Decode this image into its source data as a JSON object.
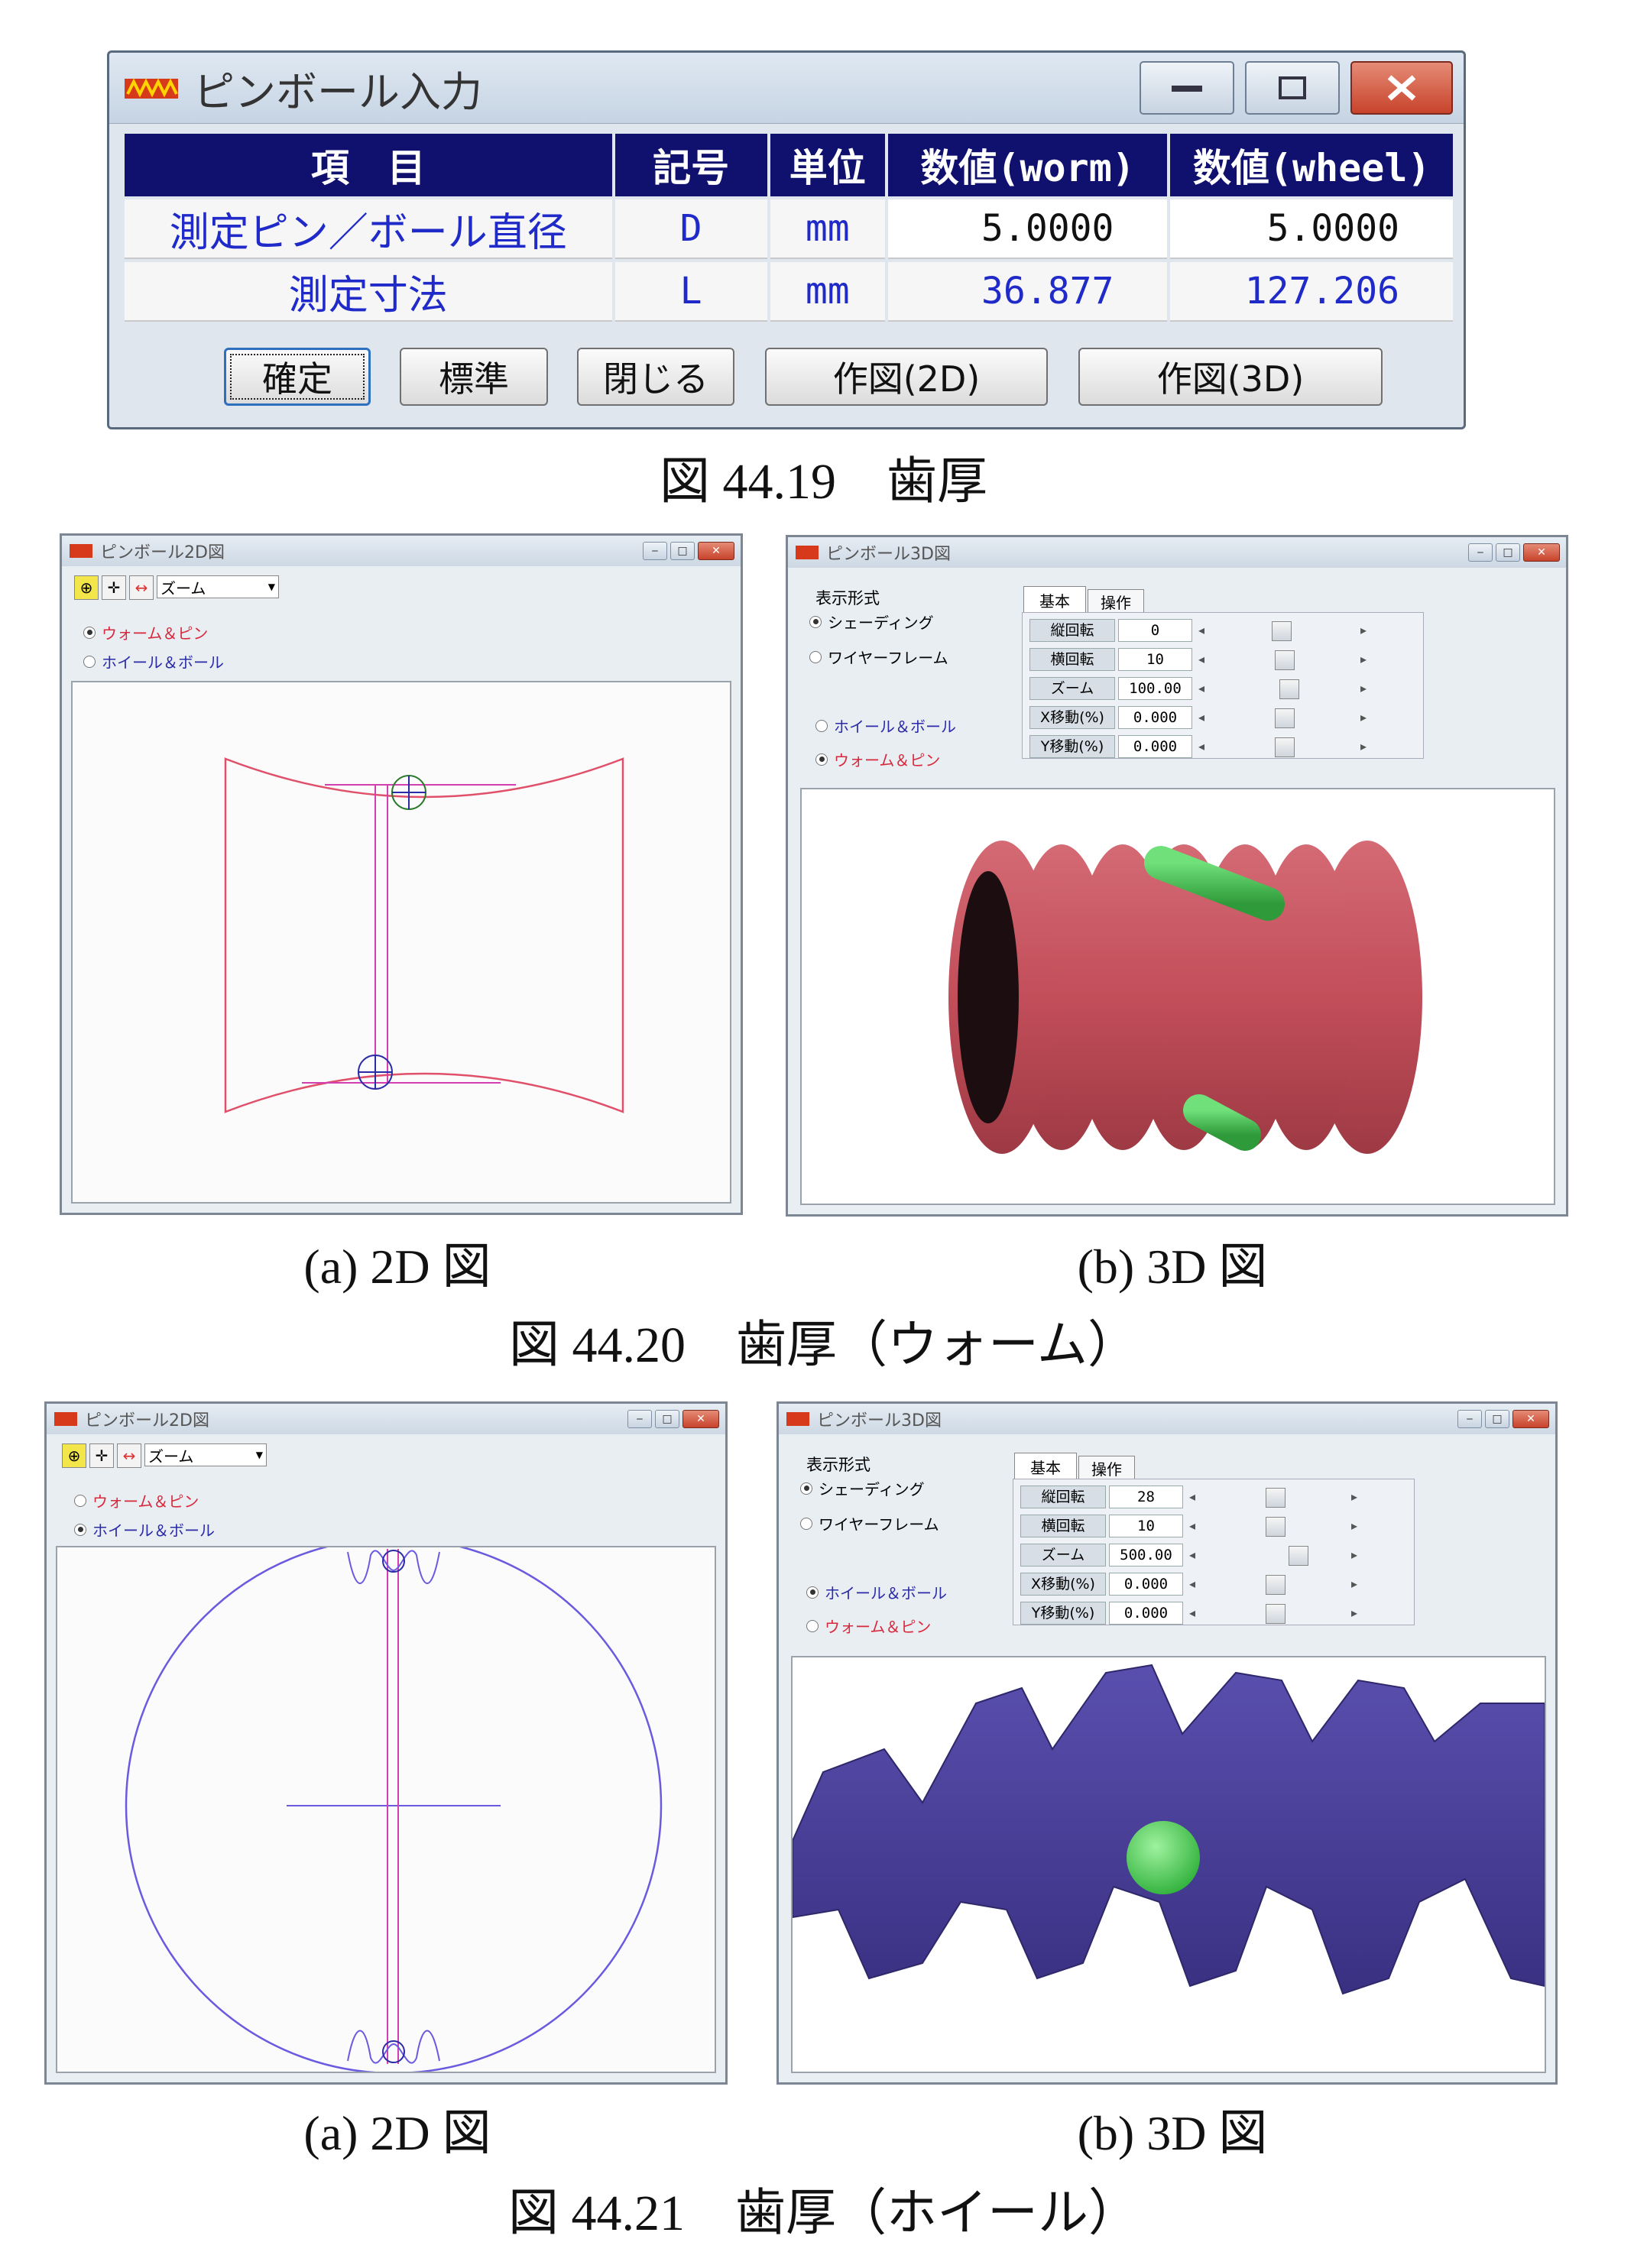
{
  "dialog": {
    "title": "ピンボール入力",
    "headers": [
      "項　目",
      "記号",
      "単位",
      "数値(worm)",
      "数値(wheel)"
    ],
    "rows": [
      [
        "測定ピン／ボール直径",
        "D",
        "mm",
        "5.0000",
        "5.0000"
      ],
      [
        "測定寸法",
        "L",
        "mm",
        "36.877",
        "127.206"
      ]
    ],
    "buttons": [
      "確定",
      "標準",
      "閉じる",
      "作図(2D)",
      "作図(3D)"
    ]
  },
  "fig1_caption": "図 44.19　歯厚",
  "fig2": {
    "win2d": {
      "title": "ピンボール2D図",
      "zoom": "ズーム",
      "radio1": "ウォーム＆ピン",
      "radio2": "ホイール＆ボール",
      "selected": 0
    },
    "win3d": {
      "title": "ピンボール3D図",
      "display_mode": "表示形式",
      "shading": "シェーディング",
      "wireframe": "ワイヤーフレーム",
      "tab_basic": "基本",
      "tab_ops": "操作",
      "controls": [
        [
          "縦回転",
          "0"
        ],
        [
          "横回転",
          "10"
        ],
        [
          "ズーム",
          "100.00"
        ],
        [
          "X移動(%)",
          "0.000"
        ],
        [
          "Y移動(%)",
          "0.000"
        ]
      ],
      "radio1": "ホイール＆ボール",
      "radio2": "ウォーム＆ピン",
      "selected": 1
    },
    "sub_a": "(a) 2D 図",
    "sub_b": "(b) 3D 図",
    "caption": "図 44.20　歯厚（ウォーム）"
  },
  "fig3": {
    "win2d": {
      "title": "ピンボール2D図",
      "zoom": "ズーム",
      "radio1": "ウォーム＆ピン",
      "radio2": "ホイール＆ボール",
      "selected": 1
    },
    "win3d": {
      "title": "ピンボール3D図",
      "display_mode": "表示形式",
      "shading": "シェーディング",
      "wireframe": "ワイヤーフレーム",
      "tab_basic": "基本",
      "tab_ops": "操作",
      "controls": [
        [
          "縦回転",
          "28"
        ],
        [
          "横回転",
          "10"
        ],
        [
          "ズーム",
          "500.00"
        ],
        [
          "X移動(%)",
          "0.000"
        ],
        [
          "Y移動(%)",
          "0.000"
        ]
      ],
      "radio1": "ホイール＆ボール",
      "radio2": "ウォーム＆ピン",
      "selected": 0
    },
    "sub_a": "(a) 2D 図",
    "sub_b": "(b) 3D 図",
    "caption": "図 44.21　歯厚（ホイール）"
  },
  "colors": {
    "header_bg": "#10106e",
    "value_text": "#1f2ac8",
    "worm_line": "#e0506a",
    "wheel_line": "#6a5ae0",
    "worm_3d": "#cf5a66",
    "wheel_3d": "#4a3f96",
    "pin_3d": "#3fc24a"
  }
}
